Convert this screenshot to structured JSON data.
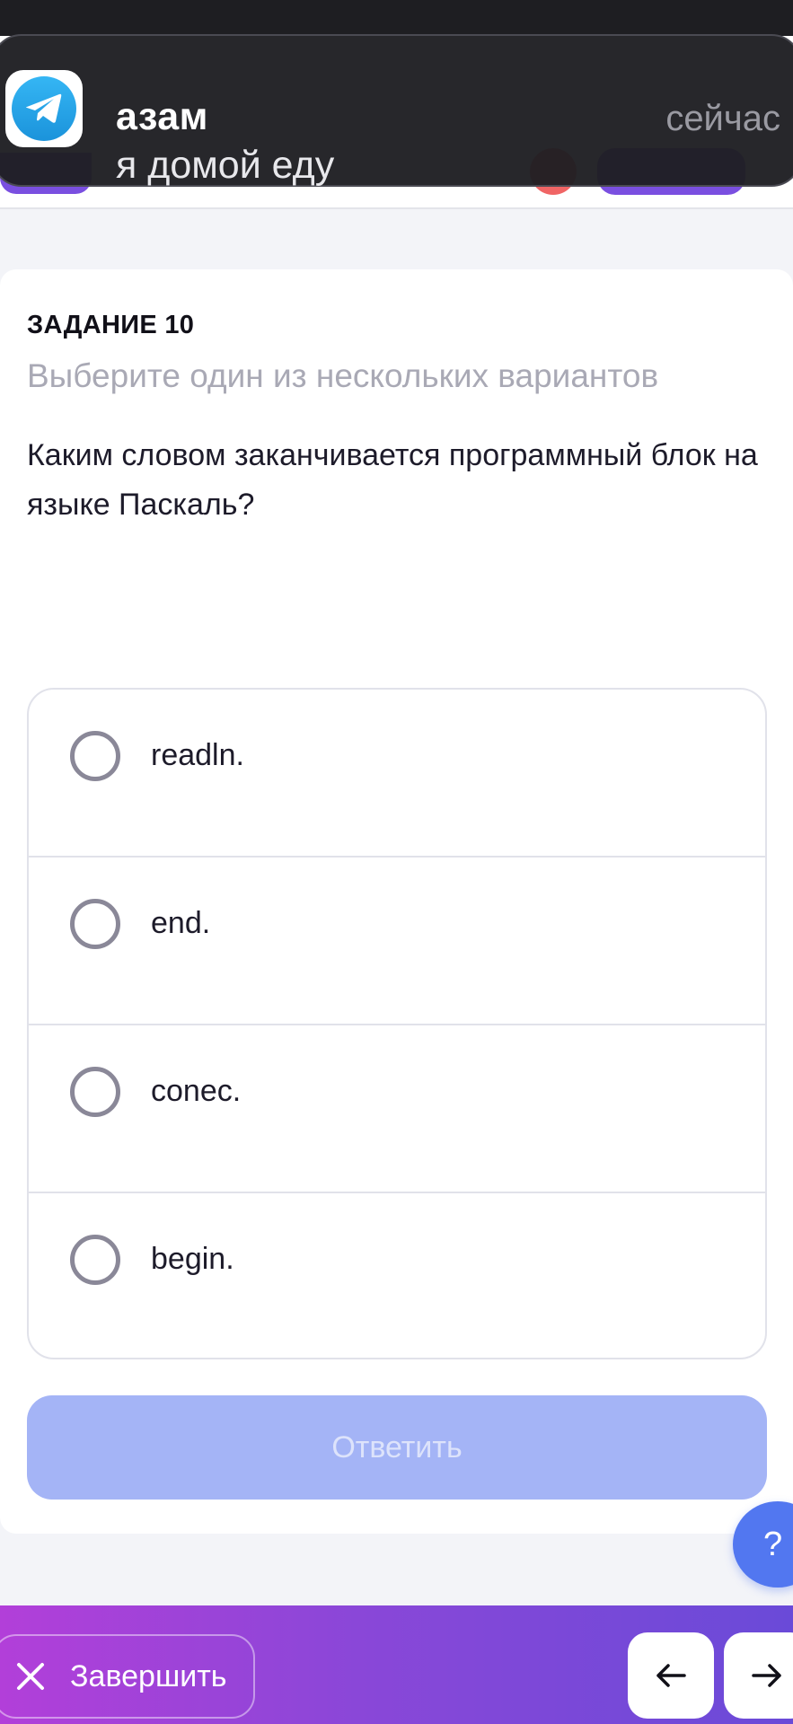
{
  "notification": {
    "sender": "азам",
    "message": "я домой еду",
    "time": "сейчас",
    "app_icon": "telegram-icon"
  },
  "task": {
    "title": "ЗАДАНИЕ 10",
    "hint": "Выберите один из нескольких вариантов",
    "question": "Каким словом заканчивается программный блок на языке Паскаль?"
  },
  "options": [
    {
      "label": "readln."
    },
    {
      "label": "end."
    },
    {
      "label": "conec."
    },
    {
      "label": "begin."
    }
  ],
  "answer_button": {
    "label": "Ответить"
  },
  "help_button": {
    "label": "?"
  },
  "bottom_bar": {
    "finish_label": "Завершить",
    "prev_icon": "arrow-left-icon",
    "next_icon": "arrow-right-icon"
  },
  "colors": {
    "accent_purple": "#7a4fe0",
    "answer_disabled": "#a4b4f6",
    "help_blue": "#5277f0",
    "bottom_gradient_start": "#b23fd9",
    "bottom_gradient_end": "#6a4ad8"
  }
}
